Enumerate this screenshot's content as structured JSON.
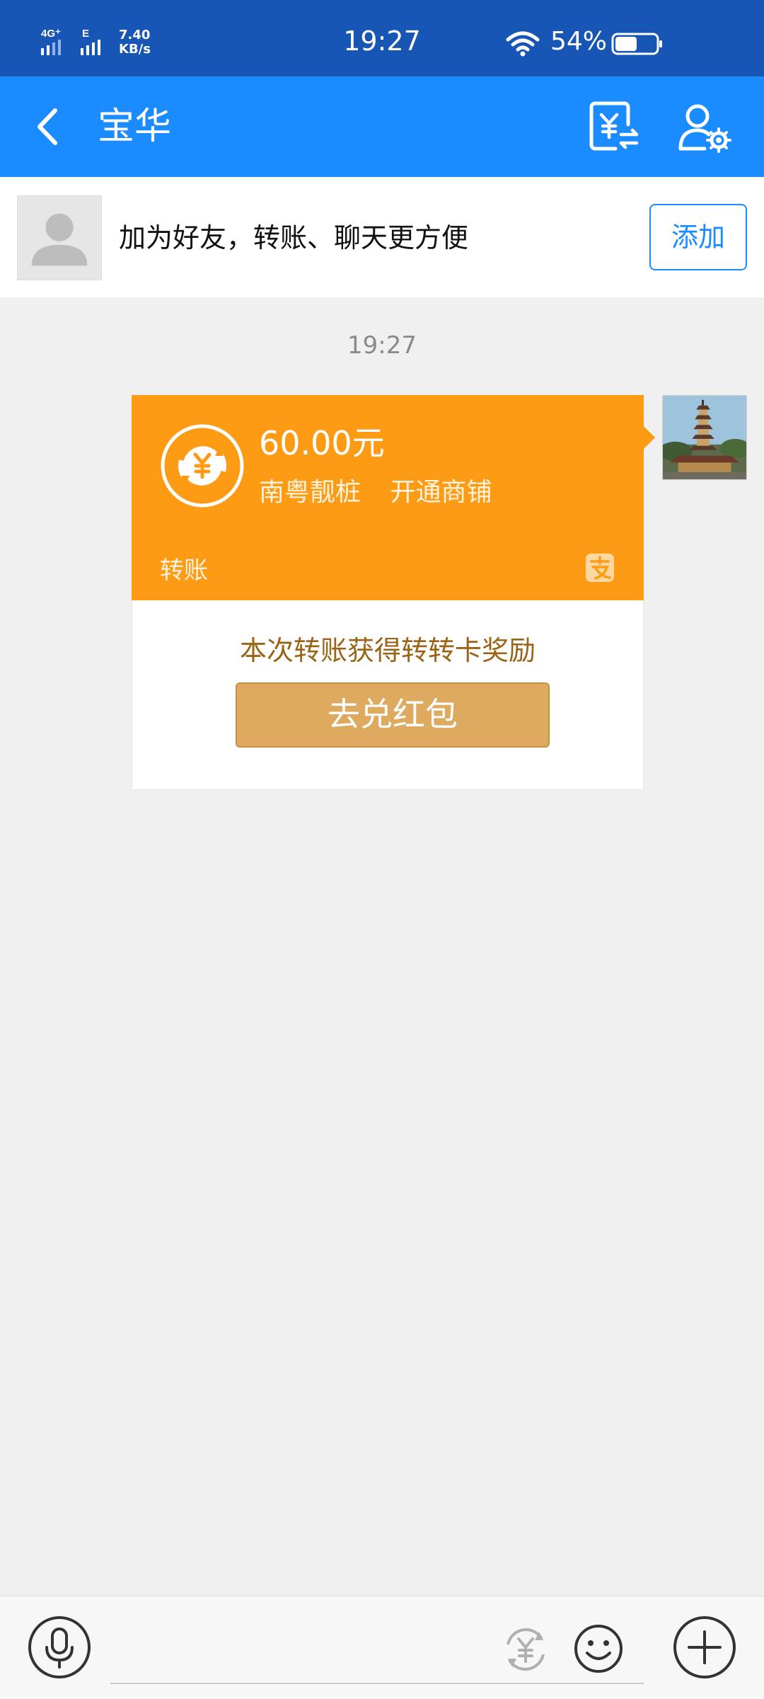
{
  "status_bar": {
    "network_type_1": "4G⁺",
    "network_type_2": "E",
    "speed_value": "7.40",
    "speed_unit": "KB/s",
    "time": "19:27",
    "battery_percent": "54%",
    "battery_level": 0.54
  },
  "nav": {
    "title": "宝华",
    "icons": [
      "back-arrow-icon",
      "transfer-money-icon",
      "contact-settings-icon"
    ]
  },
  "friend_banner": {
    "text": "加为好友，转账、聊天更方便",
    "add_label": "添加"
  },
  "chat": {
    "timestamp": "19:27",
    "transfer_card": {
      "amount": "60.00元",
      "memo": "南粤靓桩 开通商铺",
      "label": "转账",
      "reward_text": "本次转账获得转转卡奖励",
      "redeem_label": "去兑红包",
      "accent_color": "#fd9b15"
    }
  },
  "input_bar": {
    "placeholder": "",
    "icons": [
      "voice-icon",
      "transfer-icon",
      "emoji-icon",
      "plus-icon"
    ]
  },
  "colors": {
    "status_bar": "#1856b5",
    "nav_bar": "#1a8cff",
    "card_orange": "#fd9b15",
    "redeem_button": "#deaa5f",
    "reward_text": "#9a6417"
  }
}
